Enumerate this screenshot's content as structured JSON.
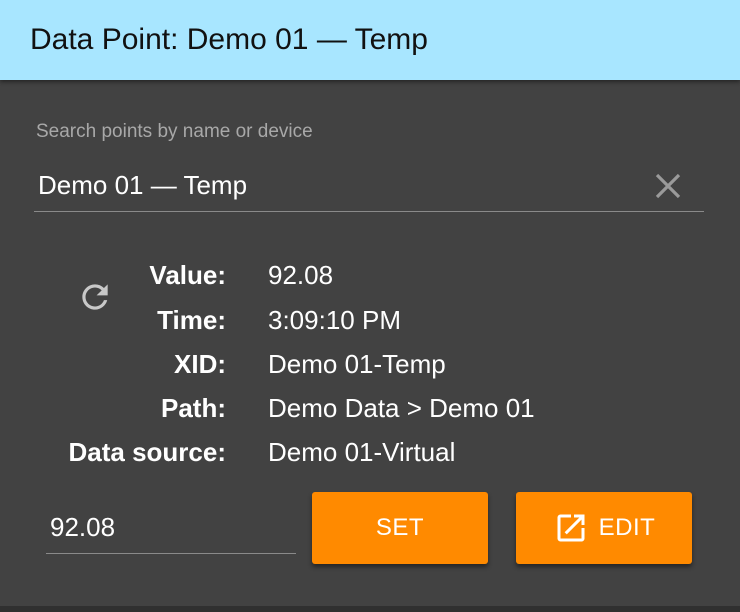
{
  "header": {
    "title": "Data Point: Demo 01 — Temp"
  },
  "search": {
    "label": "Search points by name or device",
    "value": "Demo 01 — Temp"
  },
  "point_info": {
    "rows": [
      {
        "label": "Value:",
        "value": "92.08"
      },
      {
        "label": "Time:",
        "value": "3:09:10 PM"
      },
      {
        "label": "XID:",
        "value": "Demo 01-Temp"
      },
      {
        "label": "Path:",
        "value": "Demo Data > Demo 01"
      },
      {
        "label": "Data source:",
        "value": "Demo 01-Virtual"
      }
    ]
  },
  "set_value": {
    "value": "92.08",
    "set_label": "SET",
    "edit_label": "EDIT"
  },
  "icons": {
    "clear": "close-icon",
    "refresh": "refresh-icon",
    "edit": "open-in-new-icon"
  },
  "colors": {
    "header_bg": "#a8e6ff",
    "card_bg": "#424242",
    "accent": "#ff8a00"
  }
}
